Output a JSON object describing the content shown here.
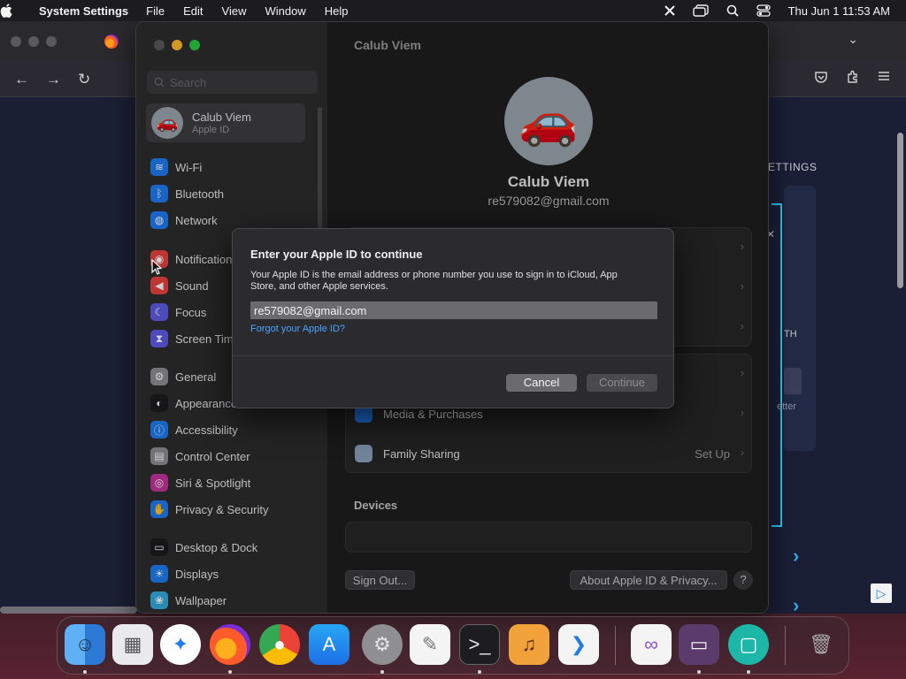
{
  "menubar": {
    "app_name": "System Settings",
    "menus": [
      "File",
      "Edit",
      "View",
      "Window",
      "Help"
    ],
    "clock": "Thu Jun 1  11:53 AM"
  },
  "browser": {
    "settings_text": "ETTINGS",
    "th_text": "TH",
    "letter_text": "etter"
  },
  "settings": {
    "search_placeholder": "Search",
    "user": {
      "name": "Calub Viem",
      "subtitle": "Apple ID",
      "email": "re579082@gmail.com",
      "avatar_emoji": "🚗"
    },
    "sidebar_items": [
      {
        "label": "Wi-Fi",
        "icon": "wifi-icon",
        "color": "#1f7cf2"
      },
      {
        "label": "Bluetooth",
        "icon": "bluetooth-icon",
        "color": "#1f7cf2"
      },
      {
        "label": "Network",
        "icon": "globe-icon",
        "color": "#1f7cf2"
      },
      {
        "label": "Notifications",
        "icon": "bell-icon",
        "color": "#e8423f"
      },
      {
        "label": "Sound",
        "icon": "speaker-icon",
        "color": "#e8423f"
      },
      {
        "label": "Focus",
        "icon": "moon-icon",
        "color": "#5e5ce6"
      },
      {
        "label": "Screen Time",
        "icon": "hourglass-icon",
        "color": "#5e5ce6"
      },
      {
        "label": "General",
        "icon": "gear-icon",
        "color": "#8e8e93"
      },
      {
        "label": "Appearance",
        "icon": "appearance-icon",
        "color": "#1c1c1e"
      },
      {
        "label": "Accessibility",
        "icon": "accessibility-icon",
        "color": "#1f7cf2"
      },
      {
        "label": "Control Center",
        "icon": "control-center-icon",
        "color": "#8e8e93"
      },
      {
        "label": "Siri & Spotlight",
        "icon": "siri-icon",
        "color": "#c1359b"
      },
      {
        "label": "Privacy & Security",
        "icon": "hand-icon",
        "color": "#1f7cf2"
      },
      {
        "label": "Desktop & Dock",
        "icon": "dock-icon",
        "color": "#1c1c1e"
      },
      {
        "label": "Displays",
        "icon": "sun-icon",
        "color": "#1f7cf2"
      },
      {
        "label": "Wallpaper",
        "icon": "wallpaper-icon",
        "color": "#34aadc"
      }
    ],
    "rows": {
      "media": "Media & Purchases",
      "family": "Family Sharing",
      "family_value": "Set Up"
    },
    "devices_label": "Devices",
    "sign_out": "Sign Out...",
    "about": "About Apple ID & Privacy...",
    "help": "?"
  },
  "dialog": {
    "title": "Enter your Apple ID to continue",
    "body": "Your Apple ID is the email address or phone number you use to sign in to iCloud, App Store, and other Apple services.",
    "input_value": "re579082@gmail.com",
    "forgot_link": "Forgot your Apple ID?",
    "cancel": "Cancel",
    "continue": "Continue"
  },
  "dock": {
    "apps": [
      {
        "name": "Finder",
        "icon": "finder-icon",
        "running": true
      },
      {
        "name": "Launchpad",
        "icon": "launchpad-icon",
        "running": false
      },
      {
        "name": "Safari",
        "icon": "safari-icon",
        "running": false
      },
      {
        "name": "Firefox",
        "icon": "firefox-icon",
        "running": true
      },
      {
        "name": "Chrome",
        "icon": "chrome-icon",
        "running": false
      },
      {
        "name": "App Store",
        "icon": "app-store-icon",
        "running": false
      },
      {
        "name": "System Settings",
        "icon": "system-settings-icon",
        "running": true
      },
      {
        "name": "TextEdit",
        "icon": "textedit-icon",
        "running": false
      },
      {
        "name": "Terminal",
        "icon": "terminal-icon",
        "running": true
      },
      {
        "name": "GarageBand",
        "icon": "garageband-icon",
        "running": false
      },
      {
        "name": "VS Code",
        "icon": "vscode-icon",
        "running": false
      },
      {
        "name": "Visual Studio",
        "icon": "visual-studio-icon",
        "running": false
      },
      {
        "name": "Remote Desktop",
        "icon": "remote-desktop-icon",
        "running": true
      },
      {
        "name": "Window App",
        "icon": "window-app-icon",
        "running": true
      },
      {
        "name": "Trash",
        "icon": "trash-icon",
        "running": false
      }
    ]
  }
}
